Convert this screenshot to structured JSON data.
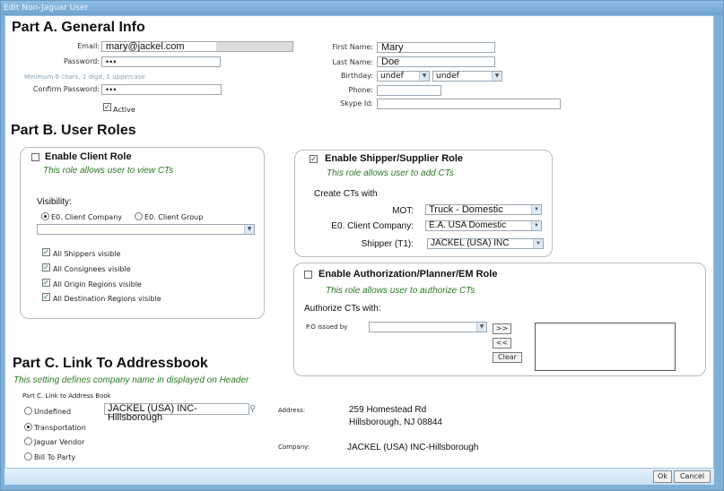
{
  "window": {
    "title": "Edit Non-Jaguar User"
  },
  "partA": {
    "heading": "Part A. General Info",
    "email_label": "Email:",
    "email_value": "mary@jackel.com",
    "password_label": "Password:",
    "password_value": "•••",
    "password_hint": "Minimum 6 chars, 1 digit, 1 uppercase",
    "confirm_label": "Confirm Password:",
    "confirm_value": "•••",
    "active_label": "Active",
    "active_checked": true,
    "first_name_label": "First Name:",
    "first_name_value": "Mary",
    "last_name_label": "Last Name:",
    "last_name_value": "Doe",
    "birthday_label": "Birthday:",
    "birthday_month": "undef",
    "birthday_day": "undef",
    "phone_label": "Phone:",
    "phone_value": "",
    "skype_label": "Skype Id:",
    "skype_value": ""
  },
  "partB": {
    "heading": "Part B. User Roles",
    "client": {
      "title": "Enable Client Role",
      "checked": false,
      "desc": "This role allows user to view CTs",
      "visibility_label": "Visibility:",
      "radio_company": "E0. Client Company",
      "radio_group": "E0. Client Group",
      "selected_radio": "E0. Client Company",
      "dropdown_value": "",
      "checks": [
        {
          "label": "All Shippers visible",
          "checked": true
        },
        {
          "label": "All Consignees visible",
          "checked": true
        },
        {
          "label": "All Origin Regions visible",
          "checked": true
        },
        {
          "label": "All Destination Regions visible",
          "checked": true
        }
      ]
    },
    "shipper": {
      "title": "Enable Shipper/Supplier Role",
      "checked": true,
      "desc": "This role allows user to add CTs",
      "create_label": "Create CTs with",
      "mot_label": "MOT:",
      "mot_value": "Truck - Domestic",
      "company_label": "E0. Client Company:",
      "company_value": "E.A. USA Domestic",
      "shipper_label": "Shipper (T1):",
      "shipper_value": "JACKEL (USA) INC"
    },
    "auth": {
      "title": "Enable Authorization/Planner/EM Role",
      "checked": false,
      "desc": "This role allows user to authorize CTs",
      "authorize_label": "Authorize CTs with:",
      "po_label": "P.O issued by",
      "po_value": "",
      "add_label": ">>",
      "remove_label": "<<",
      "clear_label": "Clear"
    }
  },
  "partC": {
    "heading": "Part C. Link To Addressbook",
    "desc": "This setting defines company name in displayed on Header",
    "sub_label": "Part C. Link to Address Book",
    "options": [
      "Undefined",
      "Transportation",
      "Jaguar Vendor",
      "Bill To Party"
    ],
    "selected": "Transportation",
    "lookup_value": "JACKEL (USA) INC-Hillsborough",
    "address_label": "Address:",
    "address_line1": "259 Homestead Rd",
    "address_line2": "Hillsborough, NJ 08844",
    "company_label": "Company:",
    "company_value": "JACKEL (USA) INC-Hillsborough"
  },
  "footer": {
    "ok_label": "Ok",
    "cancel_label": "Cancel"
  }
}
